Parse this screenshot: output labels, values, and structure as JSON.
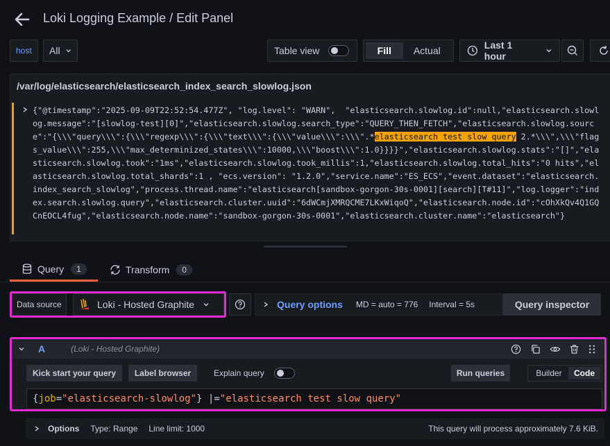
{
  "header": {
    "title": "Loki Logging Example / Edit Panel"
  },
  "toolbar": {
    "variable_label": "host",
    "variable_value": "All",
    "table_view_label": "Table view",
    "fill_label": "Fill",
    "actual_label": "Actual",
    "time_range": "Last 1 hour"
  },
  "panel": {
    "title": "/var/log/elasticsearch/elasticsearch_index_search_slowlog.json",
    "log_pre": "{\"@timestamp\":\"2025-09-09T22:52:54.477Z\", \"log.level\": \"WARN\",  \"elasticsearch.slowlog.id\":null,\"elasticsearch.slowlog.message\":\"[slowlog-test][0]\",\"elasticsearch.slowlog.search_type\":\"QUERY_THEN_FETCH\",\"elasticsearch.slowlog.source\":\"{\\\\\\\"query\\\\\\\":{\\\\\\\"regexp\\\\\\\":{\\\\\\\"text\\\\\\\":{\\\\\\\"value\\\\\\\":\\\\\\\".*",
    "log_highlight": "elasticsearch test slow query",
    "log_post": " 2.*\\\\\\\",\\\\\\\"flags_value\\\\\\\":255,\\\\\\\"max_determinized_states\\\\\\\":10000,\\\\\\\"boost\\\\\\\":1.0}}}}\",\"elasticsearch.slowlog.stats\":\"[]\",\"elasticsearch.slowlog.took\":\"1ms\",\"elasticsearch.slowlog.took_millis\":1,\"elasticsearch.slowlog.total_hits\":\"0 hits\",\"elasticsearch.slowlog.total_shards\":1 , \"ecs.version\": \"1.2.0\",\"service.name\":\"ES_ECS\",\"event.dataset\":\"elasticsearch.index_search_slowlog\",\"process.thread.name\":\"elasticsearch[sandbox-gorgon-30s-0001][search][T#11]\",\"log.logger\":\"index.search.slowlog.query\",\"elasticsearch.cluster.uuid\":\"6dWCmjXMRQCME7LKxWiqoQ\",\"elasticsearch.node.id\":\"cOhXkQv4Q1GQCnEOCL4fug\",\"elasticsearch.node.name\":\"sandbox-gorgon-30s-0001\",\"elasticsearch.cluster.name\":\"elasticsearch\"}"
  },
  "tabs": [
    {
      "label": "Query",
      "count": "1"
    },
    {
      "label": "Transform",
      "count": "0"
    }
  ],
  "datasource": {
    "label": "Data source",
    "value": "Loki - Hosted Graphite",
    "query_options_label": "Query options",
    "md": "MD = auto = 776",
    "interval": "Interval = 5s",
    "inspector_label": "Query inspector"
  },
  "query": {
    "ref": "A",
    "source": "(Loki - Hosted Graphite)",
    "kick_start": "Kick start your query",
    "label_browser": "Label browser",
    "explain": "Explain query",
    "run": "Run queries",
    "builder": "Builder",
    "code": "Code",
    "expr_open": "{",
    "expr_key": "job",
    "expr_eq": "=",
    "expr_val": "\"elasticsearch-slowlog\"",
    "expr_close": "}",
    "expr_op": " |=",
    "expr_str": "\"elasticsearch test slow query\""
  },
  "options": {
    "label": "Options",
    "type": "Type: Range",
    "limit": "Line limit: 1000",
    "estimate": "This query will process approximately 7.6 KiB."
  }
}
